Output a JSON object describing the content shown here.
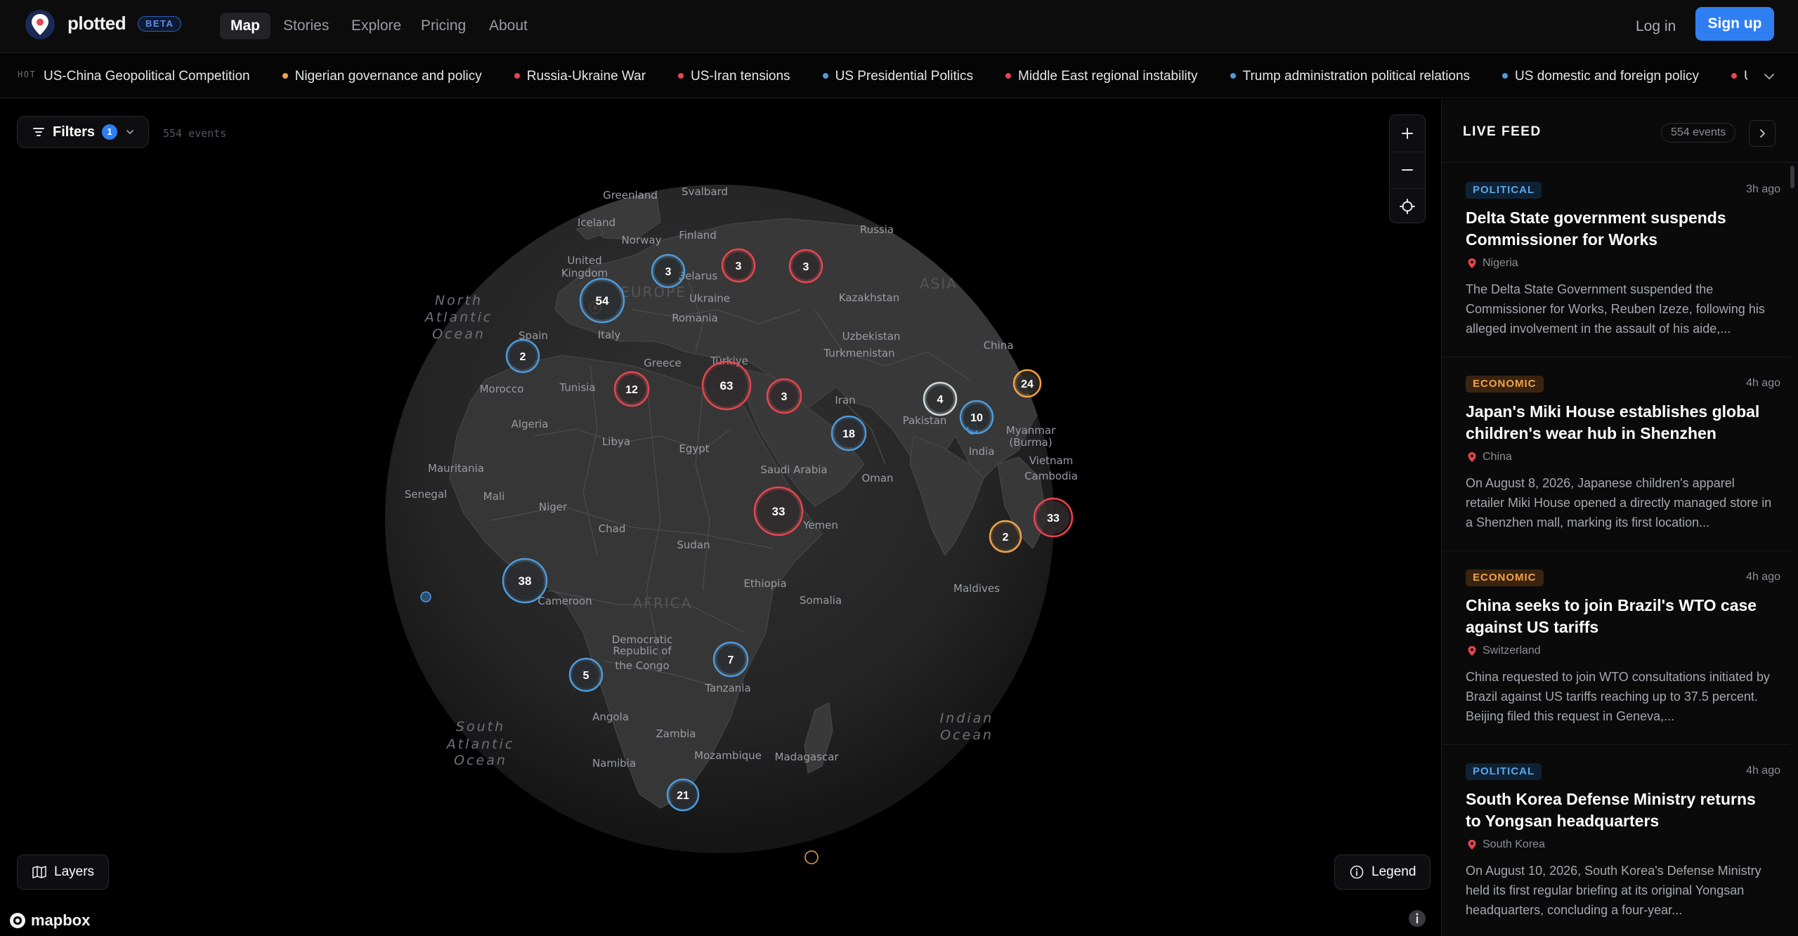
{
  "app": {
    "brand": "plotted",
    "badge": "BETA",
    "nav": [
      {
        "label": "Map",
        "active": true
      },
      {
        "label": "Stories",
        "active": false
      },
      {
        "label": "Explore",
        "active": false
      },
      {
        "label": "Pricing",
        "active": false
      },
      {
        "label": "About",
        "active": false
      }
    ],
    "login": "Log in",
    "signup": "Sign up",
    "accent": "#2f7ff2"
  },
  "ticker": {
    "label": "HOT",
    "items": [
      {
        "text": "US-China Geopolitical Competition",
        "color": ""
      },
      {
        "text": "Nigerian governance and policy",
        "color": "#f0a24a"
      },
      {
        "text": "Russia-Ukraine War",
        "color": "#e8454f"
      },
      {
        "text": "US-Iran tensions",
        "color": "#e8454f"
      },
      {
        "text": "US Presidential Politics",
        "color": "#4f9ad9"
      },
      {
        "text": "Middle East regional instability",
        "color": "#e8454f"
      },
      {
        "text": "Trump administration political relations",
        "color": "#4f9ad9"
      },
      {
        "text": "US domestic and foreign policy",
        "color": "#4f9ad9"
      },
      {
        "text": "US-China",
        "color": "#e8454f"
      }
    ]
  },
  "map": {
    "filters_label": "Filters",
    "filters_count": "1",
    "events_count": "554 events",
    "layers_label": "Layers",
    "legend_label": "Legend",
    "attribution": "mapbox",
    "place_labels": [
      {
        "text": "Greenland",
        "kind": "country"
      },
      {
        "text": "Svalbard",
        "kind": "country"
      },
      {
        "text": "Iceland",
        "kind": "country"
      },
      {
        "text": "Norway",
        "kind": "country"
      },
      {
        "text": "Finland",
        "kind": "country"
      },
      {
        "text": "Russia",
        "kind": "country"
      },
      {
        "text": "United",
        "kind": "country"
      },
      {
        "text": "Kingdom",
        "kind": "country"
      },
      {
        "text": "Belarus",
        "kind": "country"
      },
      {
        "text": "EUROPE",
        "kind": "continent"
      },
      {
        "text": "Ukraine",
        "kind": "country"
      },
      {
        "text": "Kazakhstan",
        "kind": "country"
      },
      {
        "text": "ASIA",
        "kind": "continent"
      },
      {
        "text": "North",
        "kind": "ocean"
      },
      {
        "text": "Atlantic",
        "kind": "ocean"
      },
      {
        "text": "Ocean",
        "kind": "ocean"
      },
      {
        "text": "Romania",
        "kind": "country"
      },
      {
        "text": "Spain",
        "kind": "country"
      },
      {
        "text": "Italy",
        "kind": "country"
      },
      {
        "text": "Uzbekistan",
        "kind": "country"
      },
      {
        "text": "Türkiye",
        "kind": "country"
      },
      {
        "text": "Turkmenistan",
        "kind": "country"
      },
      {
        "text": "China",
        "kind": "country"
      },
      {
        "text": "Greece",
        "kind": "country"
      },
      {
        "text": "Morocco",
        "kind": "country"
      },
      {
        "text": "Tunisia",
        "kind": "country"
      },
      {
        "text": "Iran",
        "kind": "country"
      },
      {
        "text": "Pakistan",
        "kind": "country"
      },
      {
        "text": "Myanmar",
        "kind": "country"
      },
      {
        "text": "(Burma)",
        "kind": "country"
      },
      {
        "text": "Algeria",
        "kind": "country"
      },
      {
        "text": "Libya",
        "kind": "country"
      },
      {
        "text": "Egypt",
        "kind": "country"
      },
      {
        "text": "India",
        "kind": "country"
      },
      {
        "text": "Vietnam",
        "kind": "country"
      },
      {
        "text": "Saudi Arabia",
        "kind": "country"
      },
      {
        "text": "Mauritania",
        "kind": "country"
      },
      {
        "text": "Oman",
        "kind": "country"
      },
      {
        "text": "Cambodia",
        "kind": "country"
      },
      {
        "text": "Senegal",
        "kind": "country"
      },
      {
        "text": "Mali",
        "kind": "country"
      },
      {
        "text": "Niger",
        "kind": "country"
      },
      {
        "text": "Chad",
        "kind": "country"
      },
      {
        "text": "Yemen",
        "kind": "country"
      },
      {
        "text": "Sudan",
        "kind": "country"
      },
      {
        "text": "Ethiopia",
        "kind": "country"
      },
      {
        "text": "Maldives",
        "kind": "country"
      },
      {
        "text": "Somalia",
        "kind": "country"
      },
      {
        "text": "Cameroon",
        "kind": "country"
      },
      {
        "text": "AFRICA",
        "kind": "continent"
      },
      {
        "text": "Democratic",
        "kind": "country"
      },
      {
        "text": "Republic of",
        "kind": "country"
      },
      {
        "text": "the Congo",
        "kind": "country"
      },
      {
        "text": "Tanzania",
        "kind": "country"
      },
      {
        "text": "Angola",
        "kind": "country"
      },
      {
        "text": "Zambia",
        "kind": "country"
      },
      {
        "text": "Indian",
        "kind": "ocean"
      },
      {
        "text": "Ocean",
        "kind": "ocean"
      },
      {
        "text": "South",
        "kind": "ocean"
      },
      {
        "text": "Atlantic",
        "kind": "ocean"
      },
      {
        "text": "Ocean",
        "kind": "ocean"
      },
      {
        "text": "Mozambique",
        "kind": "country"
      },
      {
        "text": "Madagascar",
        "kind": "country"
      },
      {
        "text": "Namibia",
        "kind": "country"
      }
    ],
    "clusters": [
      {
        "count": "54",
        "category": "political"
      },
      {
        "count": "3",
        "category": "political"
      },
      {
        "count": "3",
        "category": "conflict"
      },
      {
        "count": "3",
        "category": "conflict"
      },
      {
        "count": "2",
        "category": "political"
      },
      {
        "count": "12",
        "category": "conflict"
      },
      {
        "count": "63",
        "category": "conflict"
      },
      {
        "count": "3",
        "category": "conflict"
      },
      {
        "count": "18",
        "category": "political"
      },
      {
        "count": "4",
        "category": "social"
      },
      {
        "count": "10",
        "category": "political"
      },
      {
        "count": "24",
        "category": "economic"
      },
      {
        "count": "33",
        "category": "conflict"
      },
      {
        "count": "33",
        "category": "conflict"
      },
      {
        "count": "2",
        "category": "economic"
      },
      {
        "count": "38",
        "category": "political"
      },
      {
        "count": "5",
        "category": "political"
      },
      {
        "count": "7",
        "category": "political"
      },
      {
        "count": "21",
        "category": "political"
      }
    ],
    "category_colors": {
      "political": "#4f9ad9",
      "conflict": "#e8454f",
      "economic": "#f0a24a",
      "social": "#cfd8dc"
    }
  },
  "feed": {
    "title": "LIVE FEED",
    "count": "554 events",
    "items": [
      {
        "tag": "POLITICAL",
        "tag_type": "political",
        "time": "3h ago",
        "title": "Delta State government suspends Commissioner for Works",
        "location": "Nigeria",
        "description": "The Delta State Government suspended the Commissioner for Works, Reuben Izeze, following his alleged involvement in the assault of his aide,..."
      },
      {
        "tag": "ECONOMIC",
        "tag_type": "economic",
        "time": "4h ago",
        "title": "Japan's Miki House establishes global children's wear hub in Shenzhen",
        "location": "China",
        "description": "On August 8, 2026, Japanese children's apparel retailer Miki House opened a directly managed store in a Shenzhen mall, marking its first location..."
      },
      {
        "tag": "ECONOMIC",
        "tag_type": "economic",
        "time": "4h ago",
        "title": "China seeks to join Brazil's WTO case against US tariffs",
        "location": "Switzerland",
        "description": "China requested to join WTO consultations initiated by Brazil against US tariffs reaching up to 37.5 percent. Beijing filed this request in Geneva,..."
      },
      {
        "tag": "POLITICAL",
        "tag_type": "political",
        "time": "4h ago",
        "title": "South Korea Defense Ministry returns to Yongsan headquarters",
        "location": "South Korea",
        "description": "On August 10, 2026, South Korea's Defense Ministry held its first regular briefing at its original Yongsan headquarters, concluding a four-year..."
      }
    ]
  }
}
